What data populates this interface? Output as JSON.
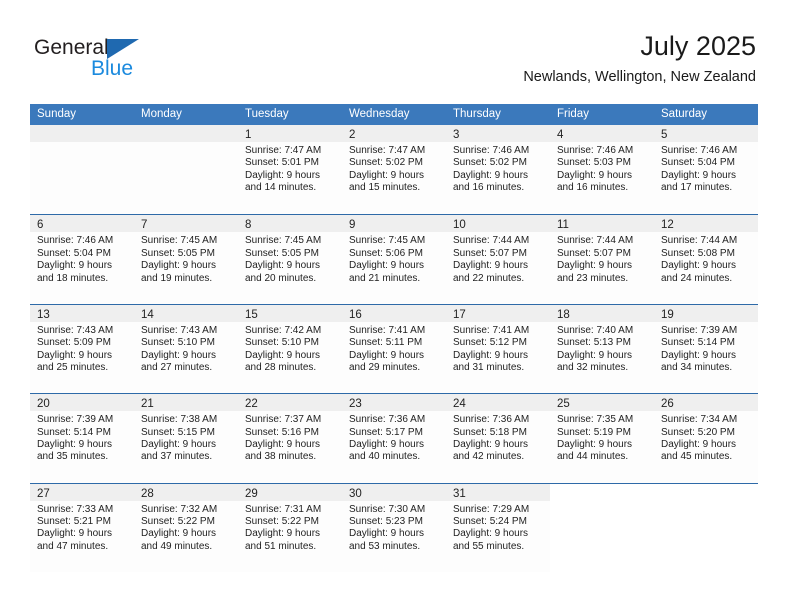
{
  "brand": {
    "name_part1": "General",
    "name_part2": "Blue",
    "triangle_color": "#1f69b0",
    "blue_color": "#1b8ade"
  },
  "header": {
    "title": "July 2025",
    "subtitle": "Newlands, Wellington, New Zealand"
  },
  "theme": {
    "header_blue": "#3b79bc",
    "row_divider_blue": "#2e6aa8",
    "date_band_gray": "#efefef"
  },
  "weekdays": [
    "Sunday",
    "Monday",
    "Tuesday",
    "Wednesday",
    "Thursday",
    "Friday",
    "Saturday"
  ],
  "weeks": [
    [
      {
        "day": "",
        "lines": []
      },
      {
        "day": "",
        "lines": []
      },
      {
        "day": "1",
        "lines": [
          "Sunrise: 7:47 AM",
          "Sunset: 5:01 PM",
          "Daylight: 9 hours",
          "and 14 minutes."
        ]
      },
      {
        "day": "2",
        "lines": [
          "Sunrise: 7:47 AM",
          "Sunset: 5:02 PM",
          "Daylight: 9 hours",
          "and 15 minutes."
        ]
      },
      {
        "day": "3",
        "lines": [
          "Sunrise: 7:46 AM",
          "Sunset: 5:02 PM",
          "Daylight: 9 hours",
          "and 16 minutes."
        ]
      },
      {
        "day": "4",
        "lines": [
          "Sunrise: 7:46 AM",
          "Sunset: 5:03 PM",
          "Daylight: 9 hours",
          "and 16 minutes."
        ]
      },
      {
        "day": "5",
        "lines": [
          "Sunrise: 7:46 AM",
          "Sunset: 5:04 PM",
          "Daylight: 9 hours",
          "and 17 minutes."
        ]
      }
    ],
    [
      {
        "day": "6",
        "lines": [
          "Sunrise: 7:46 AM",
          "Sunset: 5:04 PM",
          "Daylight: 9 hours",
          "and 18 minutes."
        ]
      },
      {
        "day": "7",
        "lines": [
          "Sunrise: 7:45 AM",
          "Sunset: 5:05 PM",
          "Daylight: 9 hours",
          "and 19 minutes."
        ]
      },
      {
        "day": "8",
        "lines": [
          "Sunrise: 7:45 AM",
          "Sunset: 5:05 PM",
          "Daylight: 9 hours",
          "and 20 minutes."
        ]
      },
      {
        "day": "9",
        "lines": [
          "Sunrise: 7:45 AM",
          "Sunset: 5:06 PM",
          "Daylight: 9 hours",
          "and 21 minutes."
        ]
      },
      {
        "day": "10",
        "lines": [
          "Sunrise: 7:44 AM",
          "Sunset: 5:07 PM",
          "Daylight: 9 hours",
          "and 22 minutes."
        ]
      },
      {
        "day": "11",
        "lines": [
          "Sunrise: 7:44 AM",
          "Sunset: 5:07 PM",
          "Daylight: 9 hours",
          "and 23 minutes."
        ]
      },
      {
        "day": "12",
        "lines": [
          "Sunrise: 7:44 AM",
          "Sunset: 5:08 PM",
          "Daylight: 9 hours",
          "and 24 minutes."
        ]
      }
    ],
    [
      {
        "day": "13",
        "lines": [
          "Sunrise: 7:43 AM",
          "Sunset: 5:09 PM",
          "Daylight: 9 hours",
          "and 25 minutes."
        ]
      },
      {
        "day": "14",
        "lines": [
          "Sunrise: 7:43 AM",
          "Sunset: 5:10 PM",
          "Daylight: 9 hours",
          "and 27 minutes."
        ]
      },
      {
        "day": "15",
        "lines": [
          "Sunrise: 7:42 AM",
          "Sunset: 5:10 PM",
          "Daylight: 9 hours",
          "and 28 minutes."
        ]
      },
      {
        "day": "16",
        "lines": [
          "Sunrise: 7:41 AM",
          "Sunset: 5:11 PM",
          "Daylight: 9 hours",
          "and 29 minutes."
        ]
      },
      {
        "day": "17",
        "lines": [
          "Sunrise: 7:41 AM",
          "Sunset: 5:12 PM",
          "Daylight: 9 hours",
          "and 31 minutes."
        ]
      },
      {
        "day": "18",
        "lines": [
          "Sunrise: 7:40 AM",
          "Sunset: 5:13 PM",
          "Daylight: 9 hours",
          "and 32 minutes."
        ]
      },
      {
        "day": "19",
        "lines": [
          "Sunrise: 7:39 AM",
          "Sunset: 5:14 PM",
          "Daylight: 9 hours",
          "and 34 minutes."
        ]
      }
    ],
    [
      {
        "day": "20",
        "lines": [
          "Sunrise: 7:39 AM",
          "Sunset: 5:14 PM",
          "Daylight: 9 hours",
          "and 35 minutes."
        ]
      },
      {
        "day": "21",
        "lines": [
          "Sunrise: 7:38 AM",
          "Sunset: 5:15 PM",
          "Daylight: 9 hours",
          "and 37 minutes."
        ]
      },
      {
        "day": "22",
        "lines": [
          "Sunrise: 7:37 AM",
          "Sunset: 5:16 PM",
          "Daylight: 9 hours",
          "and 38 minutes."
        ]
      },
      {
        "day": "23",
        "lines": [
          "Sunrise: 7:36 AM",
          "Sunset: 5:17 PM",
          "Daylight: 9 hours",
          "and 40 minutes."
        ]
      },
      {
        "day": "24",
        "lines": [
          "Sunrise: 7:36 AM",
          "Sunset: 5:18 PM",
          "Daylight: 9 hours",
          "and 42 minutes."
        ]
      },
      {
        "day": "25",
        "lines": [
          "Sunrise: 7:35 AM",
          "Sunset: 5:19 PM",
          "Daylight: 9 hours",
          "and 44 minutes."
        ]
      },
      {
        "day": "26",
        "lines": [
          "Sunrise: 7:34 AM",
          "Sunset: 5:20 PM",
          "Daylight: 9 hours",
          "and 45 minutes."
        ]
      }
    ],
    [
      {
        "day": "27",
        "lines": [
          "Sunrise: 7:33 AM",
          "Sunset: 5:21 PM",
          "Daylight: 9 hours",
          "and 47 minutes."
        ]
      },
      {
        "day": "28",
        "lines": [
          "Sunrise: 7:32 AM",
          "Sunset: 5:22 PM",
          "Daylight: 9 hours",
          "and 49 minutes."
        ]
      },
      {
        "day": "29",
        "lines": [
          "Sunrise: 7:31 AM",
          "Sunset: 5:22 PM",
          "Daylight: 9 hours",
          "and 51 minutes."
        ]
      },
      {
        "day": "30",
        "lines": [
          "Sunrise: 7:30 AM",
          "Sunset: 5:23 PM",
          "Daylight: 9 hours",
          "and 53 minutes."
        ]
      },
      {
        "day": "31",
        "lines": [
          "Sunrise: 7:29 AM",
          "Sunset: 5:24 PM",
          "Daylight: 9 hours",
          "and 55 minutes."
        ]
      },
      {
        "day": "",
        "lines": []
      },
      {
        "day": "",
        "lines": []
      }
    ]
  ]
}
